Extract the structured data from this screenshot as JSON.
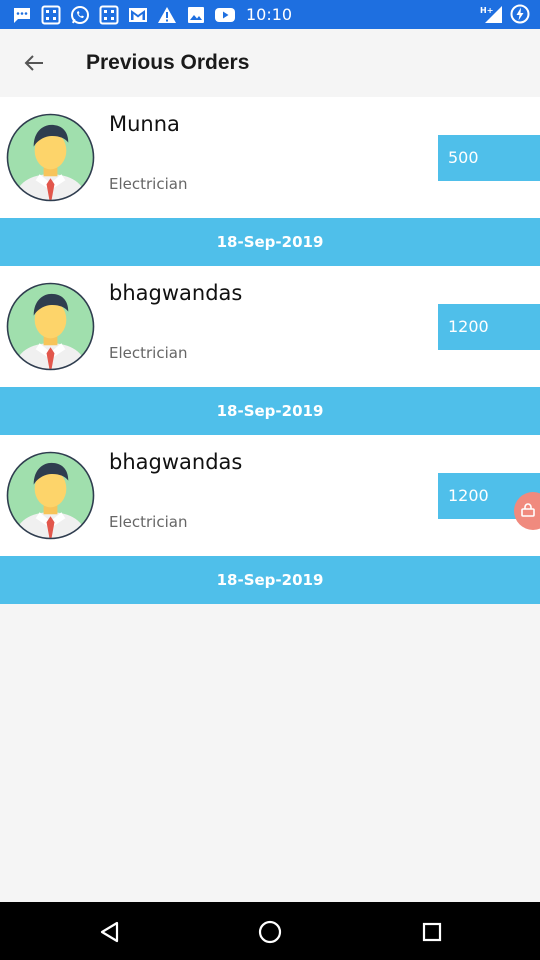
{
  "status_bar": {
    "time": "10:10",
    "left_icons": [
      "message-icon",
      "calculator-icon",
      "whatsapp-icon",
      "calculator-icon",
      "gmail-icon",
      "warning-icon",
      "image-icon",
      "youtube-icon"
    ],
    "right_icons": [
      "signal-h-plus-icon",
      "battery-charging-icon"
    ]
  },
  "header": {
    "title": "Previous Orders",
    "back_icon": "arrow-back-icon"
  },
  "orders": [
    {
      "name": "Munna",
      "role": "Electrician",
      "amount": "500",
      "date": "18-Sep-2019"
    },
    {
      "name": "bhagwandas",
      "role": "Electrician",
      "amount": "1200",
      "date": "18-Sep-2019"
    },
    {
      "name": "bhagwandas",
      "role": "Electrician",
      "amount": "1200",
      "date": "18-Sep-2019"
    }
  ],
  "nav_bar": {
    "icons": [
      "nav-back-icon",
      "nav-home-icon",
      "nav-recents-icon"
    ]
  },
  "colors": {
    "status_bar": "#1e6fe0",
    "accent": "#4fbfea",
    "background": "#f5f5f5",
    "card": "#ffffff",
    "floating_badge": "#f08a7e"
  }
}
